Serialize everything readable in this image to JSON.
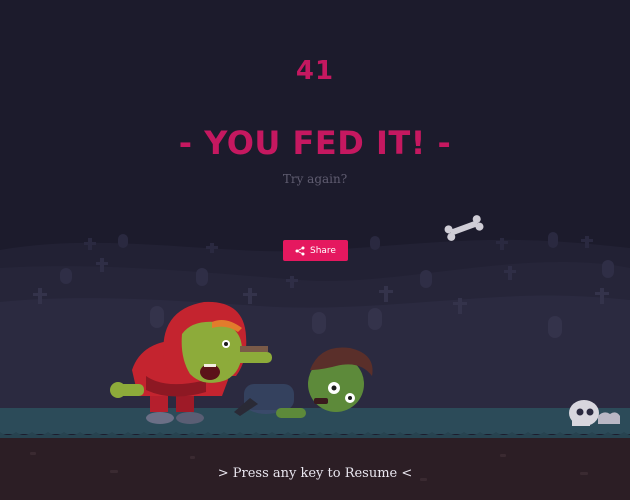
{
  "game": {
    "score": "41",
    "headline": "- YOU FED IT! -",
    "subline": "Try again?",
    "share_label": "Share",
    "resume_prompt": "> Press any key to Resume <"
  },
  "icons": {
    "share": "share-icon"
  },
  "colors": {
    "sky": "#1c1b2c",
    "accent": "#e5185f",
    "title": "#c51860",
    "hills_far": "#232237",
    "hills_mid": "#29283f",
    "grass": "#2c4a58",
    "dirt": "#2d1f26"
  }
}
